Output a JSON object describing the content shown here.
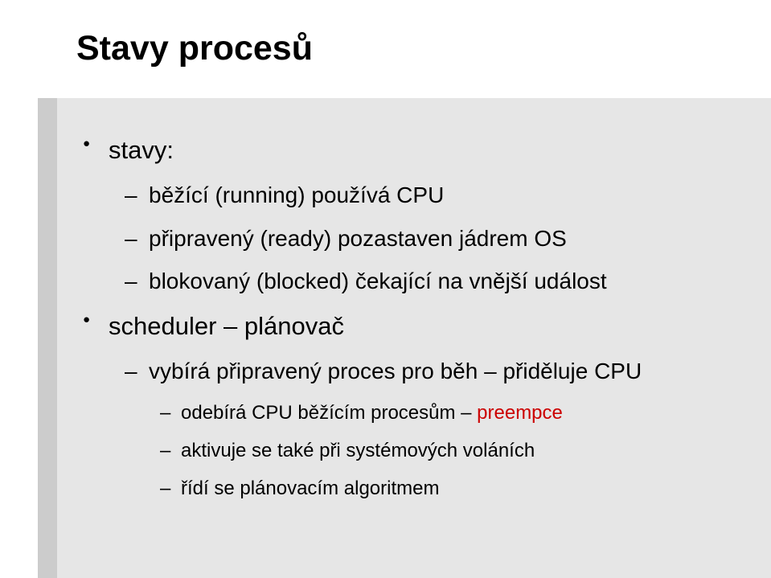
{
  "slide": {
    "title": "Stavy procesů",
    "bullet_stavy": "stavy:",
    "sub_bezici_span1": "běžící ",
    "sub_bezici_span2": "(running) používá CPU",
    "sub_pripraveny_span1": "připravený ",
    "sub_pripraveny_span2": "(ready) pozastaven jádrem OS",
    "sub_blokovany_span1": "blokovaný ",
    "sub_blokovany_span2": "(blocked) čekající na vnější událost",
    "bullet_scheduler": "scheduler – plánovač",
    "sub_vybira": "vybírá připravený proces pro běh – přiděluje CPU",
    "sub_odebira_span1": "odebírá CPU běžícím procesům – ",
    "sub_odebira_red": "preempce",
    "sub_aktivuje": "aktivuje se také při systémových voláních",
    "sub_ridi": "řídí se plánovacím algoritmem"
  }
}
